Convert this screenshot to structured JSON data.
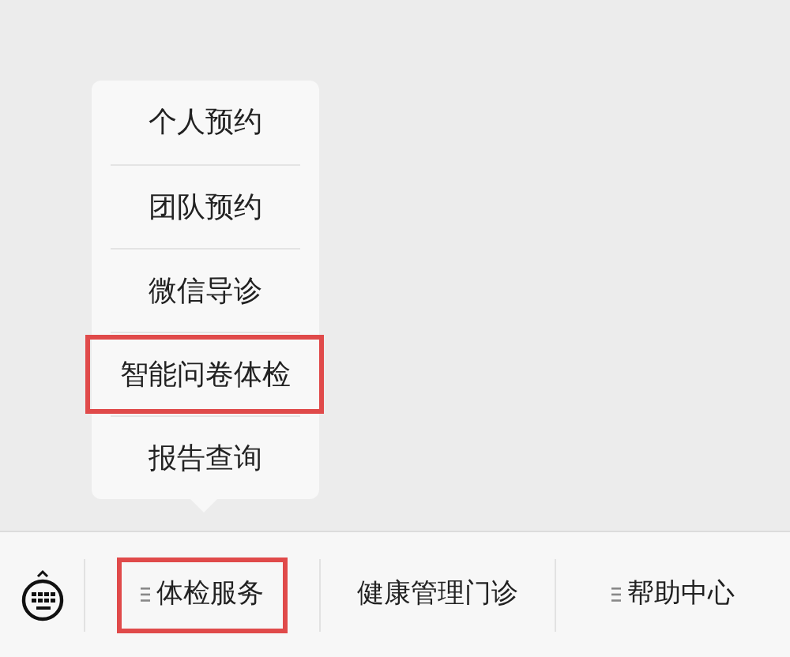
{
  "submenu": {
    "items": [
      {
        "label": "个人预约",
        "highlighted": false
      },
      {
        "label": "团队预约",
        "highlighted": false
      },
      {
        "label": "微信导诊",
        "highlighted": false
      },
      {
        "label": "智能问卷体检",
        "highlighted": true
      },
      {
        "label": "报告查询",
        "highlighted": false
      }
    ]
  },
  "menu_bar": {
    "items": [
      {
        "label": "体检服务",
        "has_submenu": true,
        "highlighted": true
      },
      {
        "label": "健康管理门诊",
        "has_submenu": false,
        "highlighted": false
      },
      {
        "label": "帮助中心",
        "has_submenu": true,
        "highlighted": false
      }
    ]
  }
}
